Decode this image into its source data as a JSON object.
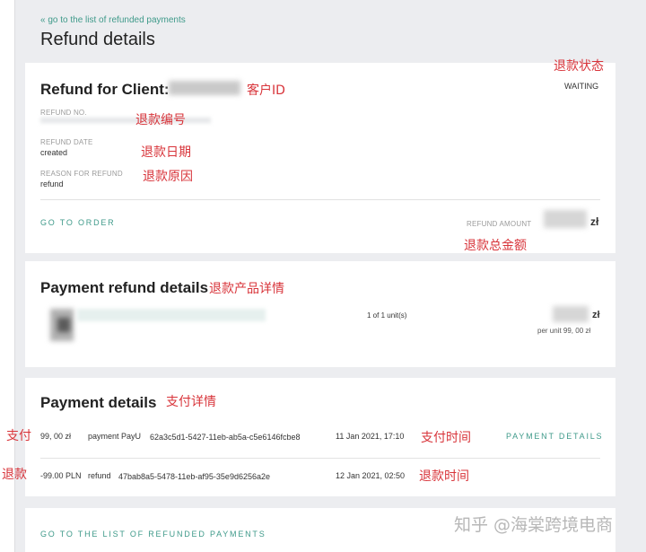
{
  "back_link": "« go to the list of refunded payments",
  "page_title": "Refund details",
  "refund_card": {
    "heading": "Refund for Client:",
    "status": "WAITING",
    "refund_no_label": "REFUND NO.",
    "refund_date_label": "REFUND DATE",
    "refund_date_value": "created",
    "reason_label": "REASON FOR REFUND",
    "reason_value": "refund",
    "go_to_order": "GO TO ORDER",
    "refund_amount_label": "REFUND AMOUNT",
    "currency": "zł"
  },
  "product_card": {
    "heading": "Payment refund details",
    "units": "1 of 1 unit(s)",
    "currency": "zł",
    "per_unit": "per unit 99, 00 zł"
  },
  "payments_card": {
    "heading": "Payment details",
    "rows": [
      {
        "amount": "99, 00 zł",
        "type": "payment PayU",
        "id": "62a3c5d1-5427-11eb-ab5a-c5e6146fcbe8",
        "date": "11 Jan 2021, 17:10",
        "action": "PAYMENT DETAILS"
      },
      {
        "amount": "-99.00 PLN",
        "type": "refund",
        "id": "47bab8a5-5478-11eb-af95-35e9d6256a2e",
        "date": "12 Jan 2021, 02:50",
        "action": ""
      }
    ]
  },
  "bottom_link": "GO TO THE LIST OF REFUNDED PAYMENTS",
  "annotations": {
    "status": "退款状态",
    "client_id": "客户ID",
    "refund_no": "退款编号",
    "refund_date": "退款日期",
    "reason": "退款原因",
    "total": "退款总金额",
    "product": "退款产品详情",
    "payment": "支付详情",
    "pay_side": "支付",
    "pay_time": "支付时间",
    "refund_side": "退款",
    "refund_time": "退款时间"
  },
  "watermark": "知乎 @海棠跨境电商",
  "colors": {
    "accent": "#3f9a8a",
    "annotation": "#d8343a",
    "background": "#ecedf0"
  }
}
